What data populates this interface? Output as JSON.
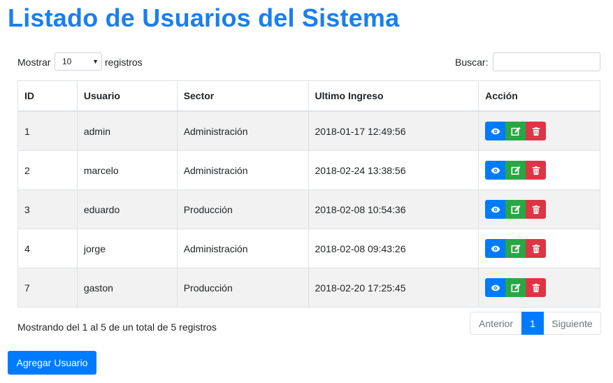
{
  "page": {
    "title": "Listado de Usuarios del Sistema"
  },
  "length_menu": {
    "prefix": "Mostrar",
    "value": "10",
    "suffix": "registros"
  },
  "search": {
    "label": "Buscar:",
    "value": ""
  },
  "table": {
    "headers": [
      "ID",
      "Usuario",
      "Sector",
      "Ultimo Ingreso",
      "Acción"
    ],
    "rows": [
      {
        "id": "1",
        "usuario": "admin",
        "sector": "Administración",
        "ultimo": "2018-01-17 12:49:56"
      },
      {
        "id": "2",
        "usuario": "marcelo",
        "sector": "Administración",
        "ultimo": "2018-02-24 13:38:56"
      },
      {
        "id": "3",
        "usuario": "eduardo",
        "sector": "Producción",
        "ultimo": "2018-02-08 10:54:36"
      },
      {
        "id": "4",
        "usuario": "jorge",
        "sector": "Administración",
        "ultimo": "2018-02-08 09:43:26"
      },
      {
        "id": "7",
        "usuario": "gaston",
        "sector": "Producción",
        "ultimo": "2018-02-20 17:25:45"
      }
    ],
    "row_actions": [
      "eye-icon",
      "edit-icon",
      "trash-icon"
    ]
  },
  "info": "Mostrando del 1 al 5 de un total de 5 registros",
  "pagination": {
    "prev": "Anterior",
    "current": "1",
    "next": "Siguiente"
  },
  "add_button": "Agregar Usuario",
  "colors": {
    "accent": "#007bff",
    "title": "#1a7ef0",
    "success": "#28a745",
    "danger": "#dc3545",
    "stripe": "#f2f2f2"
  }
}
